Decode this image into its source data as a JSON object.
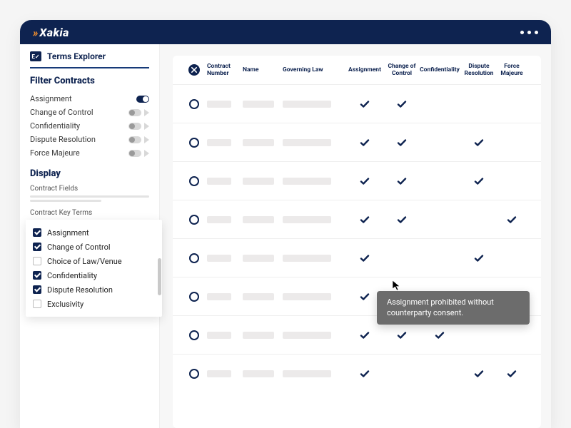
{
  "brand": {
    "name": "Xakia"
  },
  "sidebar": {
    "explorer_label": "Terms Explorer",
    "filter_title": "Filter Contracts",
    "filters": [
      {
        "label": "Assignment",
        "on": true
      },
      {
        "label": "Change of Control",
        "on": false
      },
      {
        "label": "Confidentiality",
        "on": false
      },
      {
        "label": "Dispute Resolution",
        "on": false
      },
      {
        "label": "Force Majeure",
        "on": false
      }
    ],
    "display_title": "Display",
    "contract_fields_label": "Contract Fields",
    "key_terms_label": "Contract Key Terms",
    "key_terms": [
      {
        "label": "Assignment",
        "checked": true
      },
      {
        "label": "Change of Control",
        "checked": true
      },
      {
        "label": "Choice of Law/Venue",
        "checked": false
      },
      {
        "label": "Confidentiality",
        "checked": true
      },
      {
        "label": "Dispute Resolution",
        "checked": true
      },
      {
        "label": "Exclusivity",
        "checked": false
      }
    ]
  },
  "table": {
    "headers": {
      "contract_number": "Contract Number",
      "name": "Name",
      "governing_law": "Governing Law",
      "assignment": "Assignment",
      "change_of_control": "Change of Control",
      "confidentiality": "Confidentiality",
      "dispute_resolution": "Dispute Resolution",
      "force_majeure": "Force Majeure"
    },
    "rows": [
      {
        "assignment": true,
        "change_of_control": true,
        "confidentiality": false,
        "dispute_resolution": false,
        "force_majeure": false
      },
      {
        "assignment": true,
        "change_of_control": true,
        "confidentiality": false,
        "dispute_resolution": true,
        "force_majeure": false
      },
      {
        "assignment": true,
        "change_of_control": true,
        "confidentiality": false,
        "dispute_resolution": true,
        "force_majeure": false
      },
      {
        "assignment": true,
        "change_of_control": true,
        "confidentiality": false,
        "dispute_resolution": false,
        "force_majeure": true
      },
      {
        "assignment": true,
        "change_of_control": false,
        "confidentiality": false,
        "dispute_resolution": true,
        "force_majeure": false
      },
      {
        "assignment": true,
        "change_of_control": true,
        "confidentiality": false,
        "dispute_resolution": false,
        "force_majeure": false
      },
      {
        "assignment": true,
        "change_of_control": true,
        "confidentiality": true,
        "dispute_resolution": false,
        "force_majeure": false
      },
      {
        "assignment": true,
        "change_of_control": false,
        "confidentiality": false,
        "dispute_resolution": true,
        "force_majeure": true
      }
    ]
  },
  "tooltip": {
    "text": "Assignment prohibited without counterparty consent."
  }
}
